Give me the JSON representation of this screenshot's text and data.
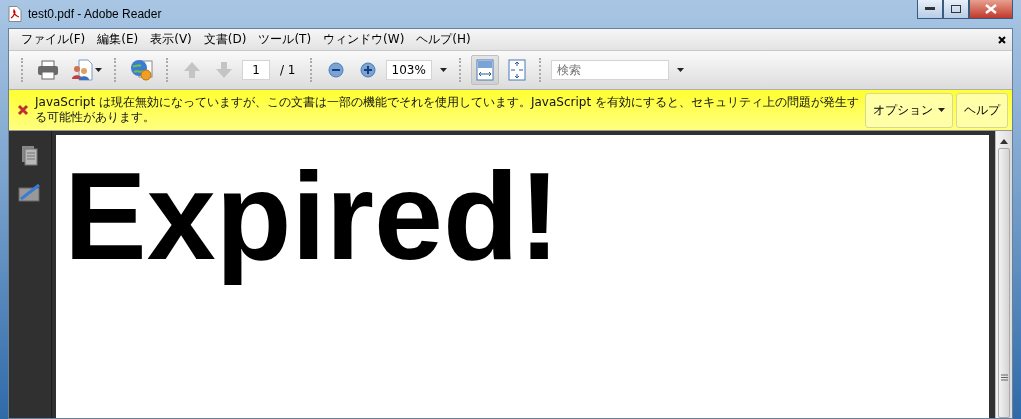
{
  "window": {
    "title": "test0.pdf - Adobe Reader"
  },
  "menu": [
    "ファイル(F)",
    "編集(E)",
    "表示(V)",
    "文書(D)",
    "ツール(T)",
    "ウィンドウ(W)",
    "ヘルプ(H)"
  ],
  "toolbar": {
    "nav": [
      {
        "kind": "up",
        "disabled": true
      },
      {
        "kind": "down",
        "disabled": true
      }
    ],
    "page_value": "1",
    "page_total": "/ 1",
    "zoom_value": "103%",
    "fit": [
      {
        "kind": "width",
        "selected": true
      },
      {
        "kind": "page",
        "selected": false
      }
    ],
    "search": {
      "placeholder": "検索"
    }
  },
  "message": {
    "text": "JavaScript は現在無効になっていますが、この文書は一部の機能でそれを使用しています。JavaScript を有効にすると、セキュリティ上の問題が発生する可能性があります。",
    "buttons": [
      {
        "label": "オプション",
        "dropdown": true
      },
      {
        "label": "ヘルプ",
        "dropdown": false
      }
    ]
  },
  "document": {
    "text": "Expired!"
  }
}
